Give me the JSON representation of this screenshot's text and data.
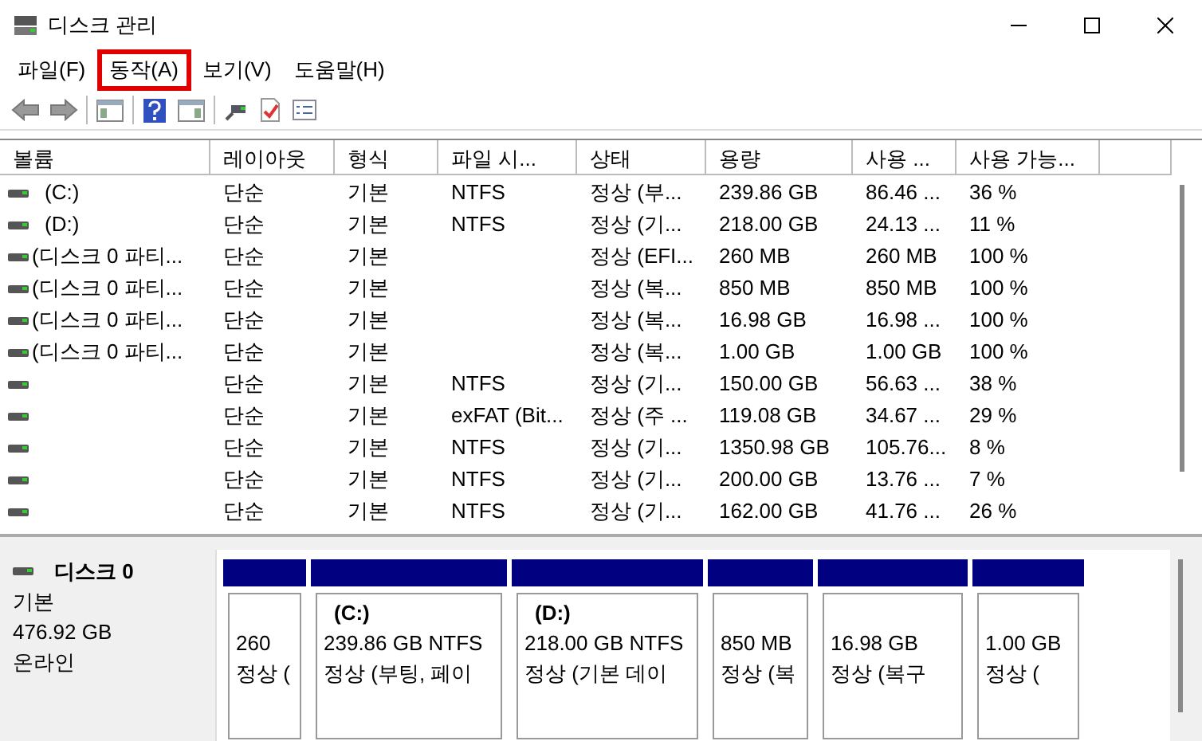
{
  "window": {
    "title": "디스크 관리"
  },
  "menu": [
    {
      "label": "파일(F)",
      "selected": false
    },
    {
      "label": "동작(A)",
      "selected": true
    },
    {
      "label": "보기(V)",
      "selected": false
    },
    {
      "label": "도움말(H)",
      "selected": false
    }
  ],
  "table": {
    "columns": [
      "볼륨",
      "레이아웃",
      "형식",
      "파일 시...",
      "상태",
      "용량",
      "사용 ...",
      "사용 가능..."
    ],
    "rows": [
      [
        "(C:)",
        "단순",
        "기본",
        "NTFS",
        "정상 (부...",
        "239.86 GB",
        "86.46 ...",
        "36 %"
      ],
      [
        "(D:)",
        "단순",
        "기본",
        "NTFS",
        "정상 (기...",
        "218.00 GB",
        "24.13 ...",
        "11 %"
      ],
      [
        "(디스크 0 파티...",
        "단순",
        "기본",
        "",
        "정상 (EFI...",
        "260 MB",
        "260 MB",
        "100 %"
      ],
      [
        "(디스크 0 파티...",
        "단순",
        "기본",
        "",
        "정상 (복...",
        "850 MB",
        "850 MB",
        "100 %"
      ],
      [
        "(디스크 0 파티...",
        "단순",
        "기본",
        "",
        "정상 (복...",
        "16.98 GB",
        "16.98 ...",
        "100 %"
      ],
      [
        "(디스크 0 파티...",
        "단순",
        "기본",
        "",
        "정상 (복...",
        "1.00 GB",
        "1.00 GB",
        "100 %"
      ],
      [
        "",
        "단순",
        "기본",
        "NTFS",
        "정상 (기...",
        "150.00 GB",
        "56.63 ...",
        "38 %"
      ],
      [
        "",
        "단순",
        "기본",
        "exFAT (Bit...",
        "정상 (주 ...",
        "119.08 GB",
        "34.67 ...",
        "29 %"
      ],
      [
        "",
        "단순",
        "기본",
        "NTFS",
        "정상 (기...",
        "1350.98 GB",
        "105.76...",
        "8 %"
      ],
      [
        "",
        "단순",
        "기본",
        "NTFS",
        "정상 (기...",
        "200.00 GB",
        "13.76 ...",
        "7 %"
      ],
      [
        "",
        "단순",
        "기본",
        "NTFS",
        "정상 (기...",
        "162.00 GB",
        "41.76 ...",
        "26 %"
      ]
    ]
  },
  "disk": {
    "name": "디스크 0",
    "type": "기본",
    "size": "476.92 GB",
    "status": "온라인",
    "partitions": [
      {
        "size": "260",
        "status": "정상 ("
      },
      {
        "label": "(C:)",
        "size": "239.86 GB NTFS",
        "status": "정상 (부팅, 페이"
      },
      {
        "label": "(D:)",
        "size": "218.00 GB NTFS",
        "status": "정상 (기본 데이"
      },
      {
        "size": "850 MB",
        "status": "정상 (복"
      },
      {
        "size": "16.98 GB",
        "status": "정상 (복구"
      },
      {
        "size": "1.00 GB",
        "status": "정상 ("
      }
    ]
  }
}
